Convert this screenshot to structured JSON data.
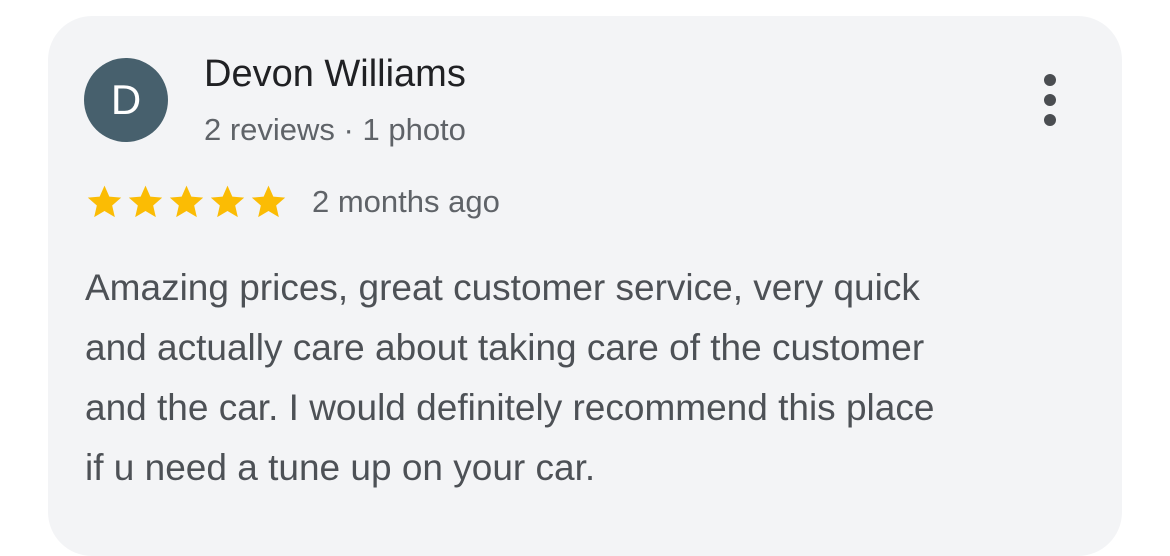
{
  "review": {
    "author": {
      "initial": "D",
      "name": "Devon Williams",
      "meta": "2 reviews · 1 photo",
      "avatar_color": "#47606d"
    },
    "rating": 5,
    "rating_max": 5,
    "date": "2 months ago",
    "text": "Amazing prices, great customer service, very quick\nand actually care about taking care of the customer\nand the car. I would definitely recommend this place\nif u need a tune up on your car.",
    "menu_icon": "more-vertical-icon"
  },
  "colors": {
    "card_background": "#f3f4f6",
    "star": "#fbbc04",
    "name_text": "#202124",
    "secondary_text": "#5f6368",
    "body_text": "#4d5156"
  }
}
